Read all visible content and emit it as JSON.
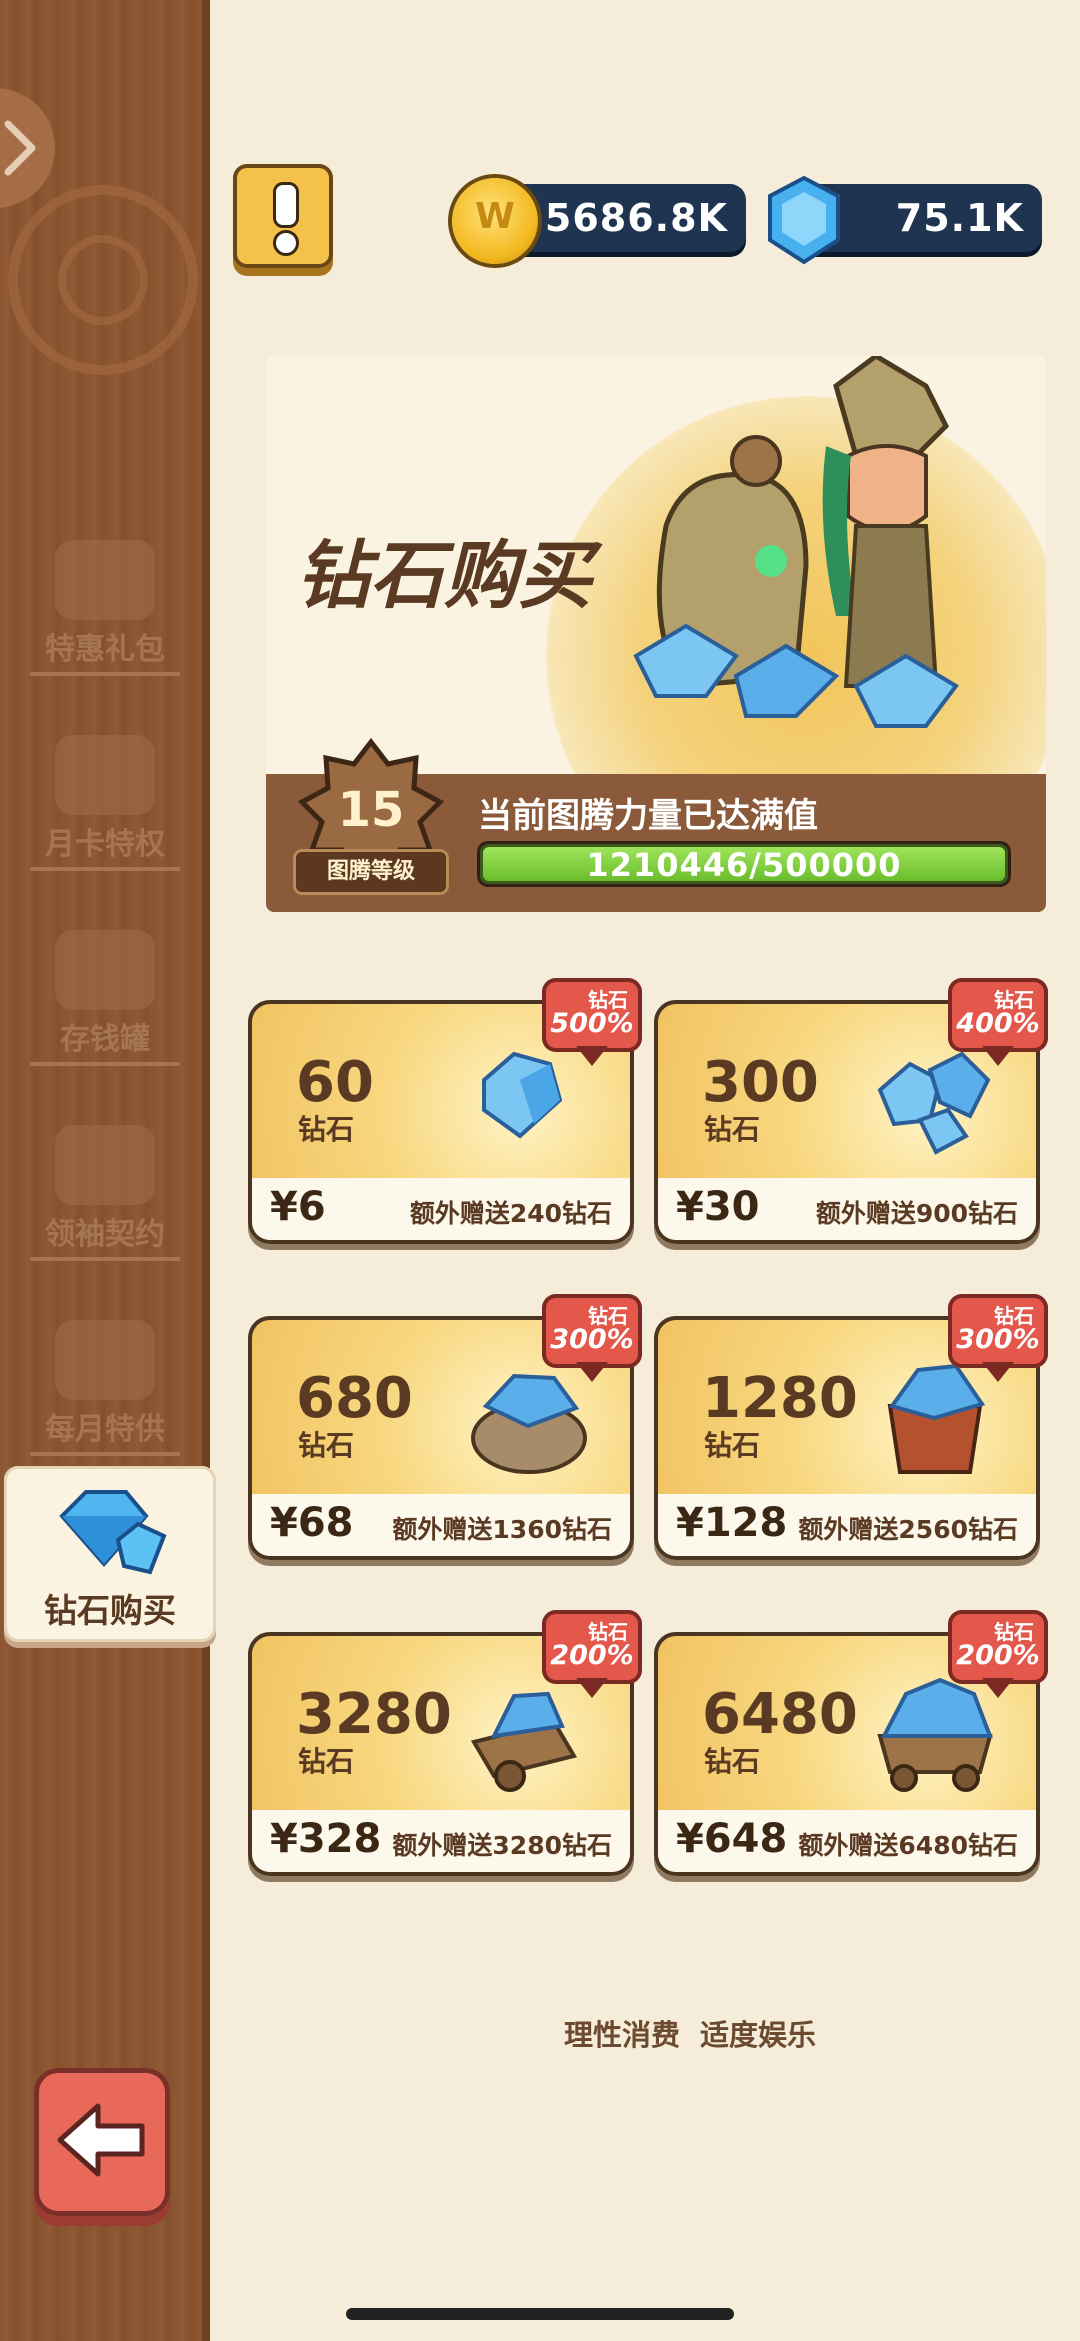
{
  "sidebar": {
    "items": [
      {
        "label": "特惠礼包",
        "icon": "gift-chest-icon"
      },
      {
        "label": "月卡特权",
        "icon": "monthly-card-icon"
      },
      {
        "label": "存钱罐",
        "icon": "piggy-bank-icon"
      },
      {
        "label": "领袖契约",
        "icon": "contract-scroll-icon"
      },
      {
        "label": "每月特供",
        "icon": "monthly-supply-icon"
      }
    ],
    "active": {
      "label": "钻石购买",
      "icon": "diamond-icon"
    }
  },
  "currency": {
    "gold": "5686.8K",
    "diamonds": "75.1K"
  },
  "banner": {
    "title": "钻石购买",
    "totem_level": "15",
    "totem_level_label": "图腾等级",
    "status_text": "当前图腾力量已达满值",
    "progress_text": "1210446/500000",
    "progress_fraction": 1.0
  },
  "offers": [
    {
      "amount": "60",
      "unit": "钻石",
      "price": "¥6",
      "bonus": "额外赠送240钻石",
      "badge_label": "钻石",
      "badge_percent": "500%"
    },
    {
      "amount": "300",
      "unit": "钻石",
      "price": "¥30",
      "bonus": "额外赠送900钻石",
      "badge_label": "钻石",
      "badge_percent": "400%"
    },
    {
      "amount": "680",
      "unit": "钻石",
      "price": "¥68",
      "bonus": "额外赠送1360钻石",
      "badge_label": "钻石",
      "badge_percent": "300%"
    },
    {
      "amount": "1280",
      "unit": "钻石",
      "price": "¥128",
      "bonus": "额外赠送2560钻石",
      "badge_label": "钻石",
      "badge_percent": "300%"
    },
    {
      "amount": "3280",
      "unit": "钻石",
      "price": "¥328",
      "bonus": "额外赠送3280钻石",
      "badge_label": "钻石",
      "badge_percent": "200%"
    },
    {
      "amount": "6480",
      "unit": "钻石",
      "price": "¥648",
      "bonus": "额外赠送6480钻石",
      "badge_label": "钻石",
      "badge_percent": "200%"
    }
  ],
  "footer_note": "理性消费 适度娱乐",
  "colors": {
    "wood": "#8a5530",
    "card_gold": "#f0c15e",
    "badge_red": "#e4574b",
    "progress_green": "#7ccf3a",
    "currency_navy": "#1f3450"
  }
}
